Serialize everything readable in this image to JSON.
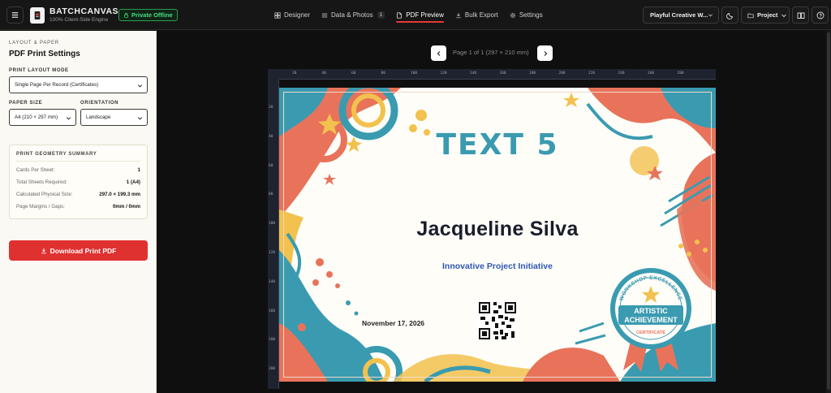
{
  "app": {
    "brand_name": "BATCHCANVAS",
    "brand_sub": "100% Client-Side Engine",
    "status_badge": "Private Offline"
  },
  "nav": {
    "designer": "Designer",
    "data_photos": "Data & Photos",
    "data_photos_count": "1",
    "pdf_preview": "PDF Preview",
    "bulk_export": "Bulk Export",
    "settings": "Settings"
  },
  "toolbar": {
    "theme_select": "Playful Creative W...",
    "project_button": "Project"
  },
  "sidebar": {
    "eyebrow": "LAYOUT & PAPER",
    "title": "PDF Print Settings",
    "layout_mode_label": "PRINT LAYOUT MODE",
    "layout_mode_value": "Single Page Per Record (Certificates)",
    "paper_size_label": "PAPER SIZE",
    "paper_size_value": "A4 (210 × 297 mm)",
    "orientation_label": "ORIENTATION",
    "orientation_value": "Landscape",
    "summary": {
      "title": "PRINT GEOMETRY SUMMARY",
      "rows": [
        {
          "key": "Cards Per Sheet:",
          "value": "1"
        },
        {
          "key": "Total Sheets Required:",
          "value": "1 (A4)"
        },
        {
          "key": "Calculated Physical Size:",
          "value": "297.0 × 199.3 mm"
        },
        {
          "key": "Page Margins / Gaps:",
          "value": "0mm / 0mm"
        }
      ]
    },
    "download_label": "Download Print PDF"
  },
  "preview": {
    "page_indicator": "Page 1 of 1 (297 × 210 mm)",
    "ruler_top": [
      "20",
      "40",
      "60",
      "80",
      "100",
      "120",
      "140",
      "160",
      "180",
      "200",
      "220",
      "240",
      "260",
      "280"
    ],
    "ruler_left": [
      "20",
      "40",
      "60",
      "80",
      "100",
      "120",
      "140",
      "160",
      "180",
      "200"
    ]
  },
  "certificate": {
    "title": "TEXT 5",
    "name": "Jacqueline Silva",
    "subtitle": "Innovative Project Initiative",
    "date": "November 17, 2026",
    "badge_top": "WORKSHOP EXCELLENCE",
    "badge_line1": "ARTISTIC",
    "badge_line2": "ACHIEVEMENT",
    "badge_bottom": "CERTIFICATE"
  },
  "colors": {
    "accent_red": "#e03131",
    "brand_teal": "#3a9bb0",
    "coral": "#e8735a",
    "mustard": "#f2c14e",
    "name_navy": "#1a1d2b",
    "subtitle_blue": "#2f56b5",
    "offline_green": "#4ade80"
  }
}
